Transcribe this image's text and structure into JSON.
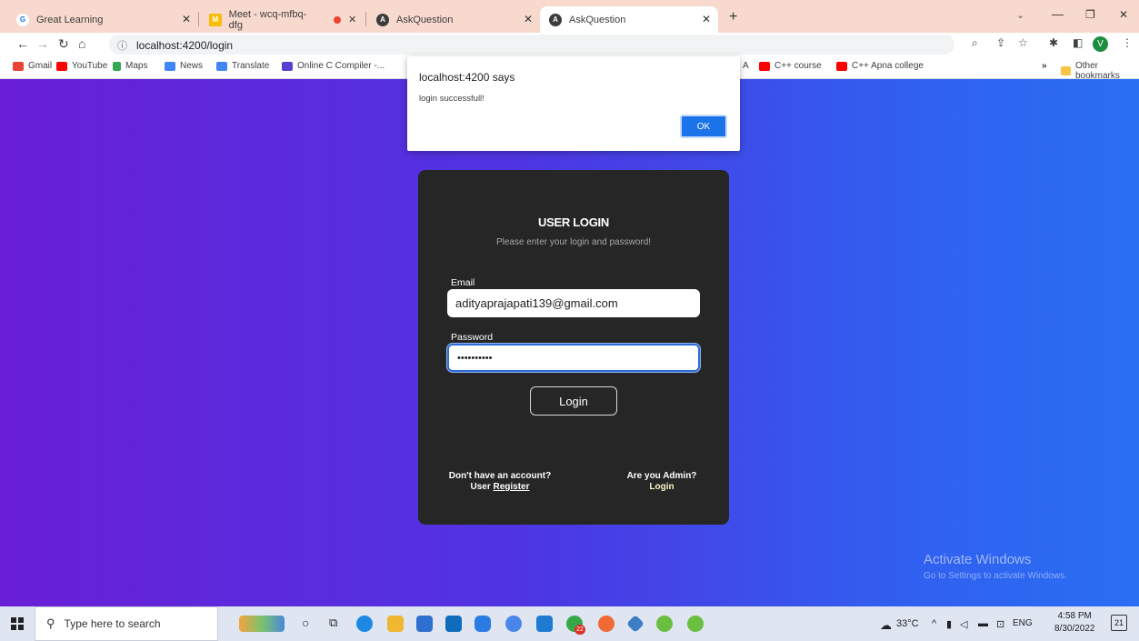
{
  "browser": {
    "tabs": [
      {
        "title": "Great Learning",
        "favicon": "G"
      },
      {
        "title": "Meet - wcq-mfbq-dfg",
        "favicon": "M"
      },
      {
        "title": "",
        "favicon": "rec"
      },
      {
        "title": "AskQuestion",
        "favicon": "A"
      },
      {
        "title": "AskQuestion",
        "favicon": "A"
      }
    ],
    "new_tab": "+",
    "url": "localhost:4200/login",
    "profile_initial": "V",
    "bookmarks": [
      "Gmail",
      "YouTube",
      "Maps",
      "News",
      "Translate",
      "Online C Compiler -...",
      "A",
      "C++ course",
      "C++ Apna college"
    ],
    "bookmarks_overflow": "»",
    "other_bookmarks": "Other bookmarks"
  },
  "alert": {
    "title": "localhost:4200 says",
    "message": "login successfull!",
    "ok_label": "OK"
  },
  "login": {
    "title": "USER LOGIN",
    "subtitle": "Please enter your login and password!",
    "email_label": "Email",
    "email_value": "adityaprajapati139@gmail.com",
    "password_label": "Password",
    "password_value": "••••••••••",
    "button_label": "Login",
    "register_prompt": "Don't have an account?",
    "register_prefix": "User",
    "register_link": "Register",
    "admin_prompt": "Are you Admin?",
    "admin_link": "Login"
  },
  "watermark": {
    "line1": "Activate Windows",
    "line2": "Go to Settings to activate Windows."
  },
  "taskbar": {
    "search_placeholder": "Type here to search",
    "weather": "33°C",
    "lang": "ENG",
    "time": "4:58 PM",
    "date": "8/30/2022",
    "notifications": "21",
    "badge": "22"
  },
  "colors": {
    "tab_strip": "#f8d9cd",
    "gradient_start": "#6a1fd6",
    "gradient_end": "#2a6ef2",
    "card": "#262626",
    "alert_button": "#1a73e8"
  }
}
